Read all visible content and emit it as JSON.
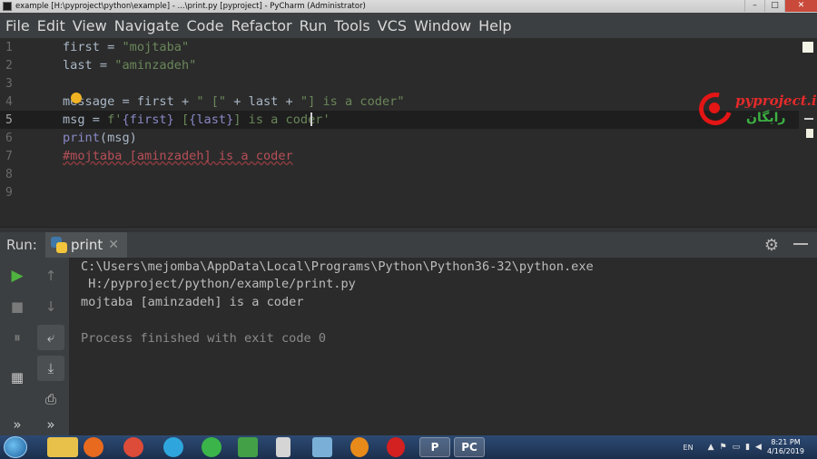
{
  "window": {
    "title": "example [H:\\pyproject\\python\\example] - ...\\print.py [pyproject] - PyCharm (Administrator)",
    "controls": [
      "–",
      "□",
      "✕"
    ]
  },
  "menu": [
    "File",
    "Edit",
    "View",
    "Navigate",
    "Code",
    "Refactor",
    "Run",
    "Tools",
    "VCS",
    "Window",
    "Help"
  ],
  "editor": {
    "line_numbers": [
      "1",
      "2",
      "3",
      "4",
      "5",
      "6",
      "7",
      "8",
      "9"
    ],
    "lines": {
      "l1_var": "first = ",
      "l1_str": "\"mojtaba\"",
      "l2_var": "last = ",
      "l2_str": "\"aminzadeh\"",
      "l4_a": "message = first + ",
      "l4_b": "\" [\"",
      "l4_c": " + last + ",
      "l4_d": "\"] is a coder\"",
      "l5_a": "msg = ",
      "l5_b": "f'",
      "l5_c": "{first}",
      "l5_d": " [",
      "l5_e": "{last}",
      "l5_f": "] is a coder'",
      "l6_fn": "print",
      "l6_rest": "(msg)",
      "l7_comment": "#mojtaba [aminzadeh] is a coder"
    }
  },
  "watermark": {
    "brand": "pyproject.ir",
    "sub": "رایگان"
  },
  "run_panel": {
    "label": "Run:",
    "tab_label": "print",
    "tab_close": "✕",
    "settings_icon": "⚙",
    "console": {
      "cmd_line1": "C:\\Users\\mejomba\\AppData\\Local\\Programs\\Python\\Python36-32\\python.exe",
      "cmd_line2": " H:/pyproject/python/example/print.py",
      "output": "mojtaba [aminzadeh] is a coder",
      "exit": "Process finished with exit code 0"
    },
    "tools": [
      "▶",
      "↑",
      "■",
      "↓",
      "⏸",
      "⤶",
      "▦",
      "⤓",
      "⎙",
      "»",
      "»"
    ]
  },
  "taskbar": {
    "apps": [
      "",
      "",
      "",
      "",
      "",
      "",
      "",
      "",
      "",
      "",
      "",
      "",
      "P",
      "PC"
    ],
    "lang": "EN",
    "time": "8:21 PM",
    "date": "4/16/2019"
  }
}
